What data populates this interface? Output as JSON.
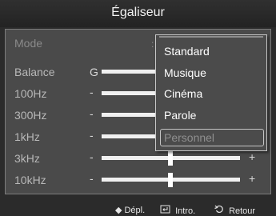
{
  "header": {
    "title": "Égaliseur"
  },
  "mode": {
    "label": "Mode",
    "value": ":"
  },
  "balance": {
    "label": "Balance",
    "left": "G"
  },
  "bands": [
    {
      "label": "100Hz",
      "minus": "-",
      "plus": "+"
    },
    {
      "label": "300Hz",
      "minus": "-",
      "plus": "+"
    },
    {
      "label": "1kHz",
      "minus": "-",
      "plus": "+"
    },
    {
      "label": "3kHz",
      "minus": "-",
      "plus": "+"
    },
    {
      "label": "10kHz",
      "minus": "-",
      "plus": "+"
    }
  ],
  "dropdown": {
    "options": [
      "Standard",
      "Musique",
      "Cinéma",
      "Parole",
      "Personnel"
    ],
    "disabled_option": "Personnel"
  },
  "footer": {
    "move_icon": "◆",
    "move_label": "Dépl.",
    "enter_icon": "enter-icon",
    "enter_label": "Intro.",
    "return_icon": "return-icon",
    "return_label": "Retour"
  }
}
